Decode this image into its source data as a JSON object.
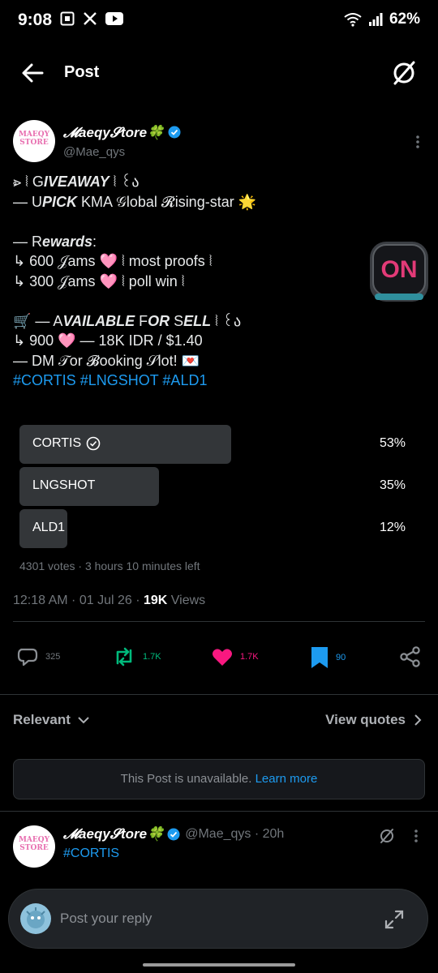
{
  "status": {
    "time": "9:08",
    "battery": "62%"
  },
  "header": {
    "title": "Post"
  },
  "post": {
    "author_name": "𝓜aeqy𝓢tore🍀",
    "author_handle": "@Mae_qys",
    "avatar_line1": "MAEQY",
    "avatar_line2": "STORE",
    "lines": [
      {
        "pre": "⩺ ⦚ G",
        "bold": "IVEAWAY",
        "post": " ⦚ ꒰ა"
      },
      {
        "pre": "— U",
        "bold": "PICK",
        "post": " KMA 𝒢lobal 𝓡ising-star 🌟"
      },
      {
        "pre": "— R",
        "bold": "ewards",
        "post": ":"
      },
      {
        "pre": "↳ 600 𝒥ams ",
        "heart": "🩷",
        "post": " ⦚ most proofs ⦚"
      },
      {
        "pre": "↳ 300 𝒥ams ",
        "heart": "🩷",
        "post": " ⦚ poll win ⦚"
      },
      {
        "pre": "🛒 — A",
        "bold": "VAILABLE",
        "mid": " F",
        "bold2": "OR",
        "mid2": " S",
        "bold3": "ELL",
        "post": " ⦚ ꒰ა"
      },
      {
        "pre": "↳ 900 ",
        "heart": "🩷",
        "post": " — 18K IDR / $1.40"
      },
      {
        "pre": "—  DM 𝒯or 𝓑ooking 𝒮lot! 💌"
      }
    ],
    "hashtags": [
      "#CORTIS",
      "#LNGSHOT",
      "#ALD1"
    ],
    "promo_text": "ON"
  },
  "poll": {
    "options": [
      {
        "label": "CORTIS",
        "percent": "53%",
        "share": 53,
        "voted": true
      },
      {
        "label": "LNGSHOT",
        "percent": "35%",
        "share": 35,
        "voted": false
      },
      {
        "label": "ALD1",
        "percent": "12%",
        "share": 12,
        "voted": false
      }
    ],
    "meta": "4301 votes · 3 hours 10 minutes left"
  },
  "timestamp": {
    "time": "12:18 AM · 01 Jul 26 · ",
    "views_count": "19K",
    "views_label": " Views"
  },
  "actions": {
    "reply_count": "325",
    "repost_count": "1.7K",
    "like_count": "1.7K",
    "bookmark_count": "90"
  },
  "colors": {
    "repost": "#00ba7c",
    "like": "#f91880",
    "bookmark": "#1d9bf0",
    "link": "#1d9bf0"
  },
  "sort": {
    "relevant_label": "Relevant",
    "view_quotes_label": "View quotes"
  },
  "unavailable": {
    "text": "This Post is unavailable. ",
    "link": "Learn more"
  },
  "reply": {
    "author_name": "𝓜aeqy𝓢tore🍀",
    "handle_time": "@Mae_qys · 20h",
    "text": "#CORTIS"
  },
  "composer": {
    "placeholder": "Post your reply"
  }
}
